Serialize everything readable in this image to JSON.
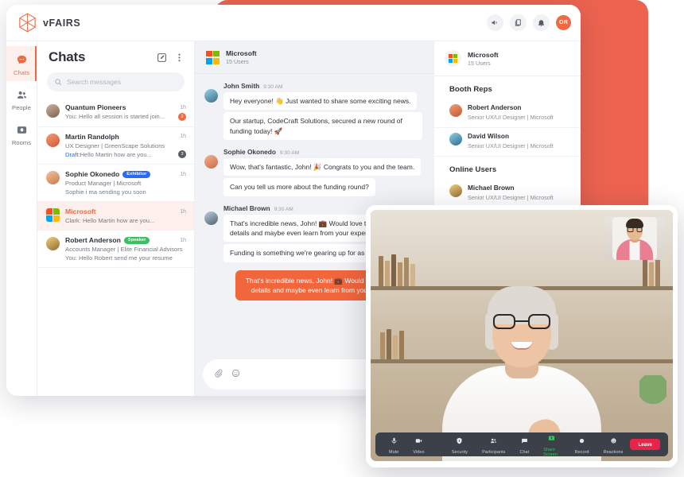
{
  "brand": {
    "name": "vFAIRS",
    "accent": "#EE6A45",
    "backdrop": "#EC6450"
  },
  "topbar": {
    "icons": [
      "megaphone-icon",
      "duplicate-icon",
      "bell-icon"
    ],
    "avatar_initials": "OR"
  },
  "rail": {
    "items": [
      {
        "label": "Chats",
        "icon": "chat-bubble-icon",
        "active": true
      },
      {
        "label": "People",
        "icon": "people-icon",
        "active": false
      },
      {
        "label": "Rooms",
        "icon": "rooms-icon",
        "active": false
      }
    ]
  },
  "chatlist": {
    "title": "Chats",
    "compose_icon": "compose-icon",
    "menu_icon": "more-vertical-icon",
    "search": {
      "placeholder": "Search messages",
      "value": "",
      "icon": "search-icon"
    },
    "rows": [
      {
        "name": "Quantum Pioneers",
        "badge": "",
        "time": "1h",
        "line1": "You: Hello all session is started join...",
        "line2": "",
        "count": "2",
        "count_style": "orange",
        "selected": false,
        "avatar": "group"
      },
      {
        "name": "Martin Randolph",
        "badge": "",
        "time": "1h",
        "line1": "UX Designer | GreenScape Solutions",
        "draft_label": "Draft:",
        "line2": " Hello Martin how are you...",
        "count": "3",
        "count_style": "dark",
        "selected": false,
        "avatar": "orange"
      },
      {
        "name": "Sophie Okonedo",
        "badge": "Exhibitor",
        "badge_color": "#2C6BED",
        "time": "1h",
        "line1": "Product Manager  | Microsoft",
        "line2": "Sophie i ma sending you soon",
        "count": "",
        "selected": false,
        "avatar": "peach"
      },
      {
        "name": "Microsoft",
        "badge": "",
        "time": "1h",
        "line1": "Clark: Hello Martin how are you...",
        "line2": "",
        "count": "",
        "selected": true,
        "avatar": "microsoft"
      },
      {
        "name": "Robert Anderson",
        "badge": "Speaker",
        "badge_color": "#3CBF63",
        "time": "1h",
        "line1": "Accounts Manager | Elite Financial Advisors",
        "line2": "You: Hello Robert send me your resume",
        "count": "",
        "selected": false,
        "avatar": "yellow"
      }
    ]
  },
  "thread": {
    "header": {
      "name": "Microsoft",
      "sub": "15 Users",
      "icon": "microsoft-logo-icon"
    },
    "groups": [
      {
        "name": "John Smith",
        "time": "9:30 AM",
        "avatar": "john",
        "bubbles": [
          "Hey everyone! 👋 Just wanted to share some exciting news.",
          "Our startup, CodeCraft Solutions, secured a new round of funding today! 🚀"
        ]
      },
      {
        "name": "Sophie Okonedo",
        "time": "9:30 AM",
        "avatar": "sophie",
        "bubbles": [
          "Wow, that's fantastic, John! 🎉 Congrats to you and the team.",
          "Can you tell us more about the funding round?"
        ]
      },
      {
        "name": "Michael Brown",
        "time": "9:30 AM",
        "avatar": "michael",
        "bubbles": [
          "That's incredible news, John! 💼 Would love to hear the details and maybe even learn from your experience.",
          "Funding is something we're gearing up for as well"
        ]
      }
    ],
    "outgoing": "That's incredible news, John! 💼 Would love to hear the details and maybe even learn from your experience.",
    "composer": {
      "placeholder": "",
      "attach_icon": "paperclip-icon",
      "emoji_icon": "emoji-icon"
    }
  },
  "members": {
    "header": {
      "name": "Microsoft",
      "sub": "15 Users",
      "icon": "microsoft-logo-icon"
    },
    "sections": [
      {
        "title": "Booth Reps",
        "people": [
          {
            "name": "Robert Anderson",
            "role": "Senior UX/UI Designer | Microsoft",
            "avatar": "robert"
          },
          {
            "name": "David Wilson",
            "role": "Senior UX/UI Designer | Microsoft",
            "avatar": "david"
          }
        ]
      },
      {
        "title": "Online Users",
        "people": [
          {
            "name": "Michael Brown",
            "role": "Senior UX/UI Designer | Microsoft",
            "avatar": "michael"
          }
        ]
      }
    ]
  },
  "video": {
    "toolbar": [
      {
        "label": "Mute",
        "icon": "microphone-icon",
        "highlight": false
      },
      {
        "label": "Video",
        "icon": "video-camera-icon",
        "highlight": false
      },
      {
        "label": "Security",
        "icon": "shield-icon",
        "highlight": false
      },
      {
        "label": "Participants",
        "icon": "participants-icon",
        "highlight": false
      },
      {
        "label": "Chat",
        "icon": "chat-icon",
        "highlight": false
      },
      {
        "label": "Share Screen",
        "icon": "share-screen-icon",
        "highlight": true
      },
      {
        "label": "Record",
        "icon": "record-icon",
        "highlight": false
      },
      {
        "label": "Reactions",
        "icon": "reactions-icon",
        "highlight": false
      }
    ],
    "leave_label": "Leave",
    "leave_color": "#E8244A"
  }
}
